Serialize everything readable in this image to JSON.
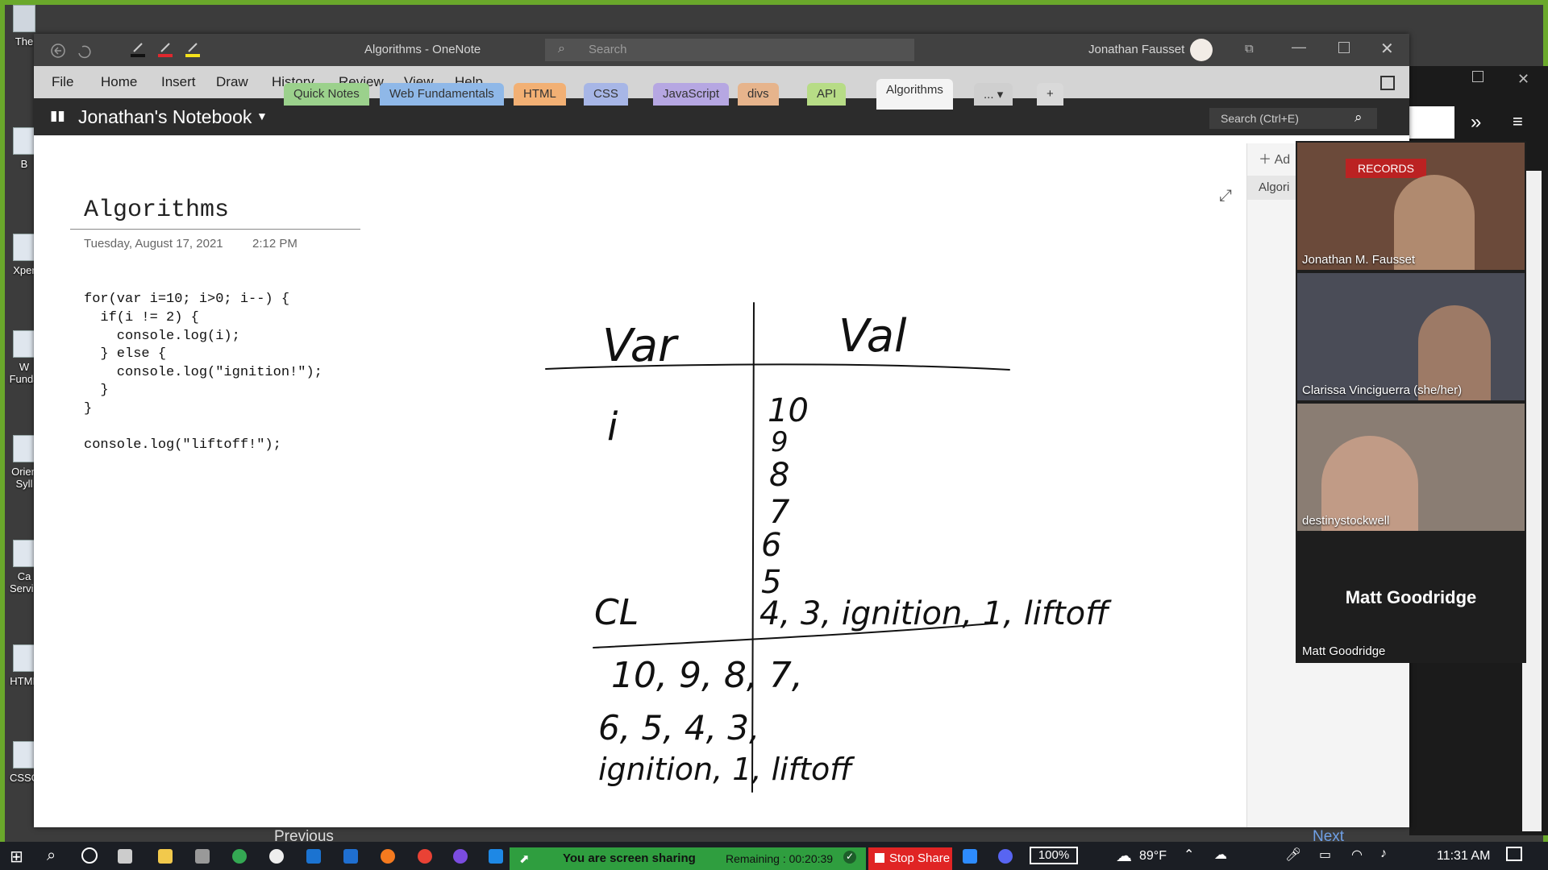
{
  "desktop": {
    "icons": [
      {
        "label": "The",
        "icon": "recycle-bin-icon"
      },
      {
        "label": "B",
        "icon": "document-icon"
      },
      {
        "label": "Xper",
        "icon": "document-icon"
      },
      {
        "label": "W Funda",
        "icon": "document-icon"
      },
      {
        "label": "Orien Syll",
        "icon": "document-icon"
      },
      {
        "label": "Ca Servic",
        "icon": "document-icon"
      },
      {
        "label": "HTML",
        "icon": "document-icon"
      },
      {
        "label": "CSSC",
        "icon": "document-icon"
      }
    ]
  },
  "onenote": {
    "title": "Algorithms  -  OneNote",
    "search_placeholder": "Search",
    "user": "Jonathan Fausset",
    "menu": [
      "File",
      "Home",
      "Insert",
      "Draw",
      "History",
      "Review",
      "View",
      "Help"
    ],
    "notebook": "Jonathan's Notebook",
    "sections": [
      {
        "label": "Quick Notes",
        "color": "#9bd18c"
      },
      {
        "label": "Web Fundamentals",
        "color": "#8fb8e8"
      },
      {
        "label": "HTML",
        "color": "#f2b074"
      },
      {
        "label": "CSS",
        "color": "#a7b6e6"
      },
      {
        "label": "JavaScript",
        "color": "#b6a7e2"
      },
      {
        "label": "divs",
        "color": "#e6b48c"
      },
      {
        "label": "API",
        "color": "#b7dc86"
      },
      {
        "label": "Algorithms",
        "color": "#f4f4f4"
      },
      {
        "label": "...",
        "color": "#cfcfcf"
      },
      {
        "label": "+",
        "color": "#d9d9d9"
      }
    ],
    "search_box": "Search (Ctrl+E)",
    "right_pane": {
      "add_label": "Ad",
      "page_label": "Algori"
    },
    "page": {
      "title": "Algorithms",
      "date": "Tuesday, August 17, 2021",
      "time": "2:12 PM",
      "code": [
        "for(var i=10; i>0; i--) {",
        "  if(i != 2) {",
        "    console.log(i);",
        "  } else {",
        "    console.log(\"ignition!\");",
        "  }",
        "}",
        "",
        "console.log(\"liftoff!\");"
      ],
      "ink": {
        "var_header": "Var",
        "val_header": "Val",
        "var_value": "i",
        "val_values": [
          "10",
          "9",
          "8",
          "7",
          "6",
          "5"
        ],
        "val_last": "4, 3, ignition, 1, liftoff",
        "cl_label": "CL",
        "output_lines": [
          "10, 9, 8, 7,",
          "6, 5, 4, 3,",
          "ignition, 1, liftoff"
        ]
      }
    },
    "bottom_nav": {
      "prev": "Previous",
      "next": "Next"
    }
  },
  "zoom": {
    "participants": [
      {
        "name": "Jonathan M. Fausset",
        "bg": "#6b4a3a"
      },
      {
        "name": "Clarissa Vinciguerra (she/her)",
        "bg": "#4a4c57"
      },
      {
        "name": "destinystockwell",
        "bg": "#8a7d73"
      },
      {
        "name": "Matt Goodridge",
        "bg": "#1e1e1e",
        "big_name": "Matt Goodridge"
      }
    ]
  },
  "share": {
    "status": "You are screen sharing",
    "remaining": "Remaining : 00:20:39",
    "stop": "Stop Share"
  },
  "taskbar": {
    "battery": "100%",
    "temp": "89°F",
    "time": "11:31 AM"
  }
}
